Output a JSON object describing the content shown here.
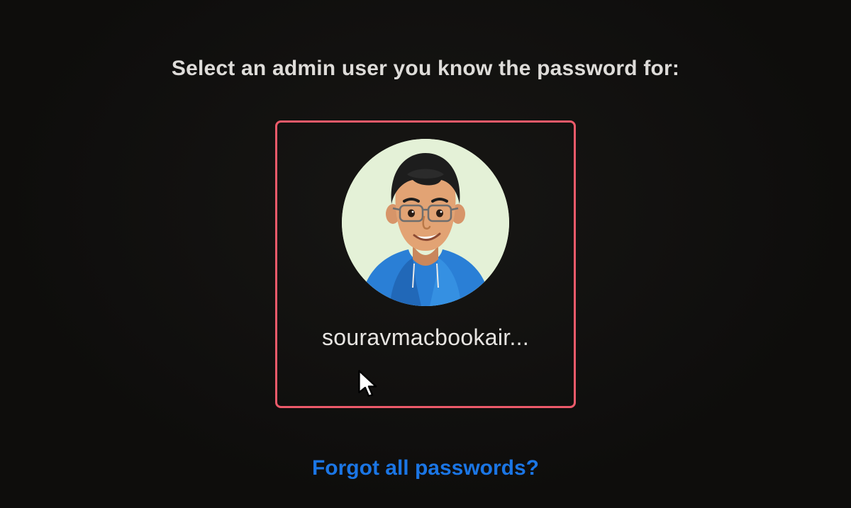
{
  "prompt": "Select an admin user you know the password for:",
  "users": [
    {
      "name": "souravmacbookair..."
    }
  ],
  "forgot_link": "Forgot all passwords?",
  "colors": {
    "highlight": "#ec5a6a",
    "link": "#1b76e5",
    "avatar_bg": "#e4f1d7"
  }
}
